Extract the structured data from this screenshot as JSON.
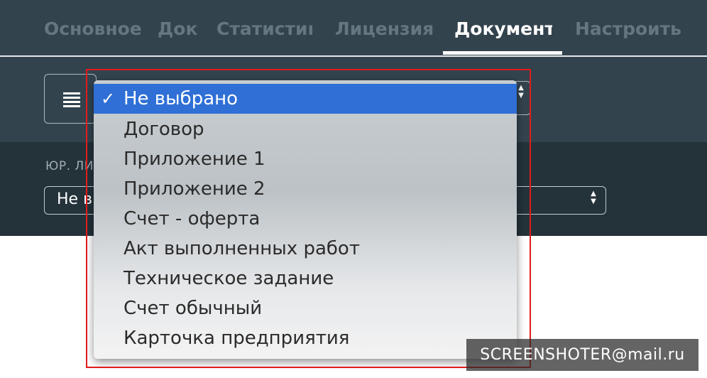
{
  "nav": {
    "tabs": [
      {
        "label": "Основное"
      },
      {
        "label": "Док"
      },
      {
        "label": "Статистика"
      },
      {
        "label": "Лицензия"
      },
      {
        "label": "Документы"
      },
      {
        "label": "Настроить"
      }
    ],
    "active_tab": "Документы"
  },
  "toolbar": {
    "menu_icon": "list-icon",
    "document_type_select": {
      "options": [
        "Не выбрано",
        "Договор",
        "Приложение 1",
        "Приложение 2",
        "Счет - оферта",
        "Акт выполненных работ",
        "Техническое задание",
        "Счет обычный",
        "Карточка предприятия"
      ],
      "selected": "Не выбрано",
      "checkmark": "✓"
    }
  },
  "filter": {
    "label": "ЮР. ЛИ",
    "entity_select_value": "Не в"
  },
  "watermark": "SCREENSHOTER@mail.ru",
  "colors": {
    "nav_bg": "#33434e",
    "filter_bg": "#24323a",
    "selected_option": "#2f6fd6",
    "highlight_box": "#e11b1b"
  }
}
